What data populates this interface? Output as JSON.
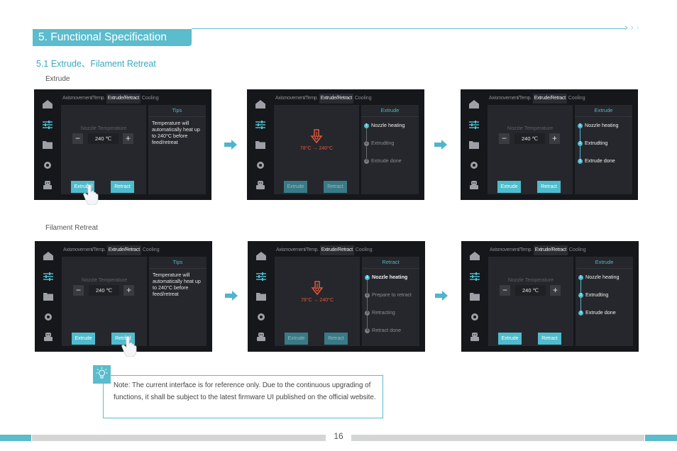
{
  "header": {
    "section_title": "5. Functional Specification",
    "subsection_title": "5.1 Extrude、Filament Retreat",
    "accent_color": "#5bbccc"
  },
  "groups": [
    {
      "caption": "Extrude",
      "screens": [
        {
          "tabs": [
            "Axismovement/Temp.",
            "Extrude/Retract",
            "Cooling"
          ],
          "active_tab": "Extrude/Retract",
          "nozzle_label": "Nozzle Temperature",
          "temp_value": "240 ℃",
          "minus": "−",
          "plus": "+",
          "right_title": "Tips",
          "tips": "Temperature will automatically heat up to 240°C before feed/retreat",
          "buttons": [
            "Extrude",
            "Retract"
          ],
          "pressed": "Extrude"
        },
        {
          "tabs": [
            "Axismovement/Temp.",
            "Extrude/Retract",
            "Cooling"
          ],
          "active_tab": "Extrude/Retract",
          "heating_text": "78°C → 240°C",
          "right_title": "Extrude",
          "steps": [
            {
              "num": "1",
              "label": "Nozzle heating",
              "state": "active"
            },
            {
              "num": "2",
              "label": "Extrudting",
              "state": "pending"
            },
            {
              "num": "3",
              "label": "Extrude done",
              "state": "pending"
            }
          ],
          "buttons": [
            "Extrude",
            "Retract"
          ],
          "buttons_disabled": true
        },
        {
          "tabs": [
            "Axismovement/Temp.",
            "Extrude/Retract",
            "Cooling"
          ],
          "active_tab": "Extrude/Retract",
          "nozzle_label": "Nozzle Temperature",
          "temp_value": "240 ℃",
          "minus": "−",
          "plus": "+",
          "right_title": "Extrude",
          "steps": [
            {
              "num": "1",
              "label": "Nozzle heating",
              "state": "done"
            },
            {
              "num": "2",
              "label": "Extrudting",
              "state": "done"
            },
            {
              "num": "3",
              "label": "Extrude done",
              "state": "done"
            }
          ],
          "buttons": [
            "Extrude",
            "Retract"
          ]
        }
      ]
    },
    {
      "caption": "Filament Retreat",
      "screens": [
        {
          "tabs": [
            "Axismovement/Temp.",
            "Extrude/Retract",
            "Cooling"
          ],
          "active_tab": "Extrude/Retract",
          "nozzle_label": "Nozzle Temperature",
          "temp_value": "240 ℃",
          "minus": "−",
          "plus": "+",
          "right_title": "Tips",
          "tips": "Temperature will automatically heat up to 240°C before feed/retreat",
          "buttons": [
            "Extrude",
            "Retract"
          ],
          "pressed": "Retract"
        },
        {
          "tabs": [
            "Axismovement/Temp.",
            "Extrude/Retract",
            "Cooling"
          ],
          "active_tab": "Extrude/Retract",
          "heating_text": "78°C → 240°C",
          "right_title": "Retract",
          "steps": [
            {
              "num": "1",
              "label": "Nozzle heating",
              "state": "active"
            },
            {
              "num": "2",
              "label": "Prepare to retract",
              "state": "pending"
            },
            {
              "num": "3",
              "label": "Retracting",
              "state": "pending"
            },
            {
              "num": "4",
              "label": "Retract done",
              "state": "pending"
            }
          ],
          "buttons": [
            "Extrude",
            "Retract"
          ],
          "buttons_disabled": true
        },
        {
          "tabs": [
            "Axismovement/Temp.",
            "Extrude/Retract",
            "Cooling"
          ],
          "active_tab": "Extrude/Retract",
          "nozzle_label": "Nozzle Temperature",
          "temp_value": "240 ℃",
          "minus": "−",
          "plus": "+",
          "right_title": "Extrude",
          "steps": [
            {
              "num": "1",
              "label": "Nozzle heating",
              "state": "done"
            },
            {
              "num": "2",
              "label": "Extrudting",
              "state": "done"
            },
            {
              "num": "3",
              "label": "Extrude done",
              "state": "done"
            }
          ],
          "buttons": [
            "Extrude",
            "Retract"
          ]
        }
      ]
    }
  ],
  "note": {
    "text": "Note: The current interface is for reference only. Due to the continuous upgrading of functions, it shall be subject to the latest firmware UI published on the official website."
  },
  "footer": {
    "page_number": "16"
  },
  "icons": {
    "sidebar": [
      "home-icon",
      "adjust-icon",
      "folder-icon",
      "settings-icon",
      "robot-icon"
    ],
    "flow": "right-arrow-icon",
    "note": "lightbulb-icon",
    "pointer": "hand-pointer-icon"
  }
}
